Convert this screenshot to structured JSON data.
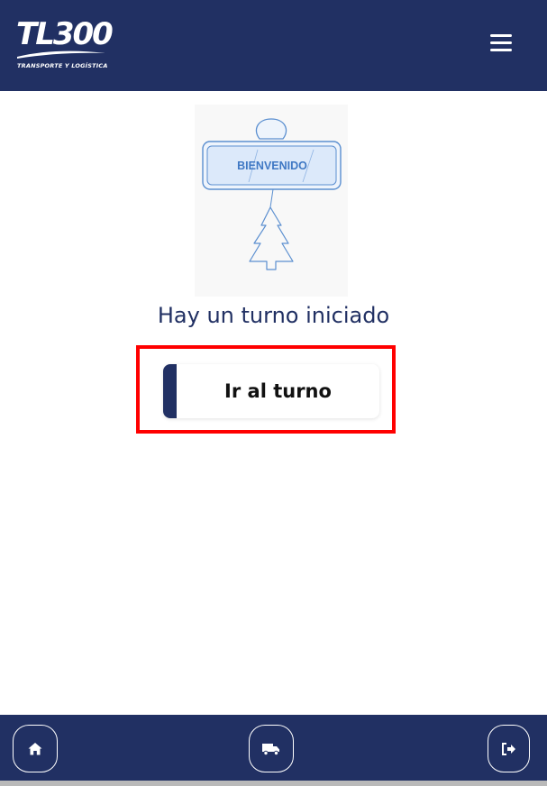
{
  "header": {
    "logo_text": "TL300",
    "logo_subtitle": "TRANSPORTE Y LOGÍSTICA",
    "menu_icon": "hamburger-menu-icon"
  },
  "illustration": {
    "sign_text": "BIENVENIDO"
  },
  "main": {
    "status_message": "Hay un turno iniciado",
    "go_button_label": "Ir al turno"
  },
  "footer": {
    "nav": [
      {
        "icon": "home-icon"
      },
      {
        "icon": "truck-icon"
      },
      {
        "icon": "logout-icon"
      }
    ]
  },
  "colors": {
    "primary": "#213063",
    "highlight": "#ff0000",
    "background": "#ffffff"
  }
}
